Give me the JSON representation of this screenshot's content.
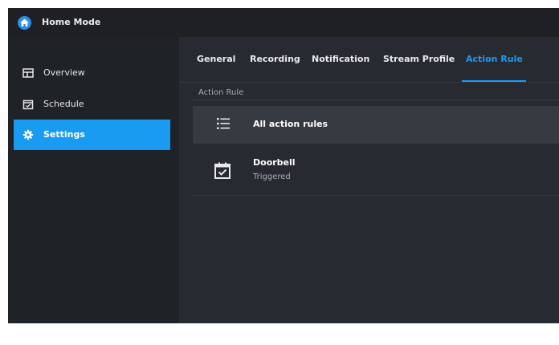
{
  "app": {
    "title": "Home Mode",
    "icon": "home-icon",
    "accent": "#1a9bf2"
  },
  "sidebar": {
    "items": [
      {
        "label": "Overview",
        "icon": "overview-icon",
        "active": false
      },
      {
        "label": "Schedule",
        "icon": "calendar-check-icon",
        "active": false
      },
      {
        "label": "Settings",
        "icon": "gear-icon",
        "active": true
      }
    ]
  },
  "tabs": [
    {
      "label": "General",
      "active": false
    },
    {
      "label": "Recording",
      "active": false
    },
    {
      "label": "Notification",
      "active": false
    },
    {
      "label": "Stream Profile",
      "active": false
    },
    {
      "label": "Action Rule",
      "active": true
    }
  ],
  "section": {
    "label": "Action Rule"
  },
  "list": {
    "all_label": "All action rules",
    "all_icon": "list-icon",
    "rules": [
      {
        "name": "Doorbell",
        "status": "Triggered",
        "icon": "calendar-check-icon"
      }
    ]
  }
}
